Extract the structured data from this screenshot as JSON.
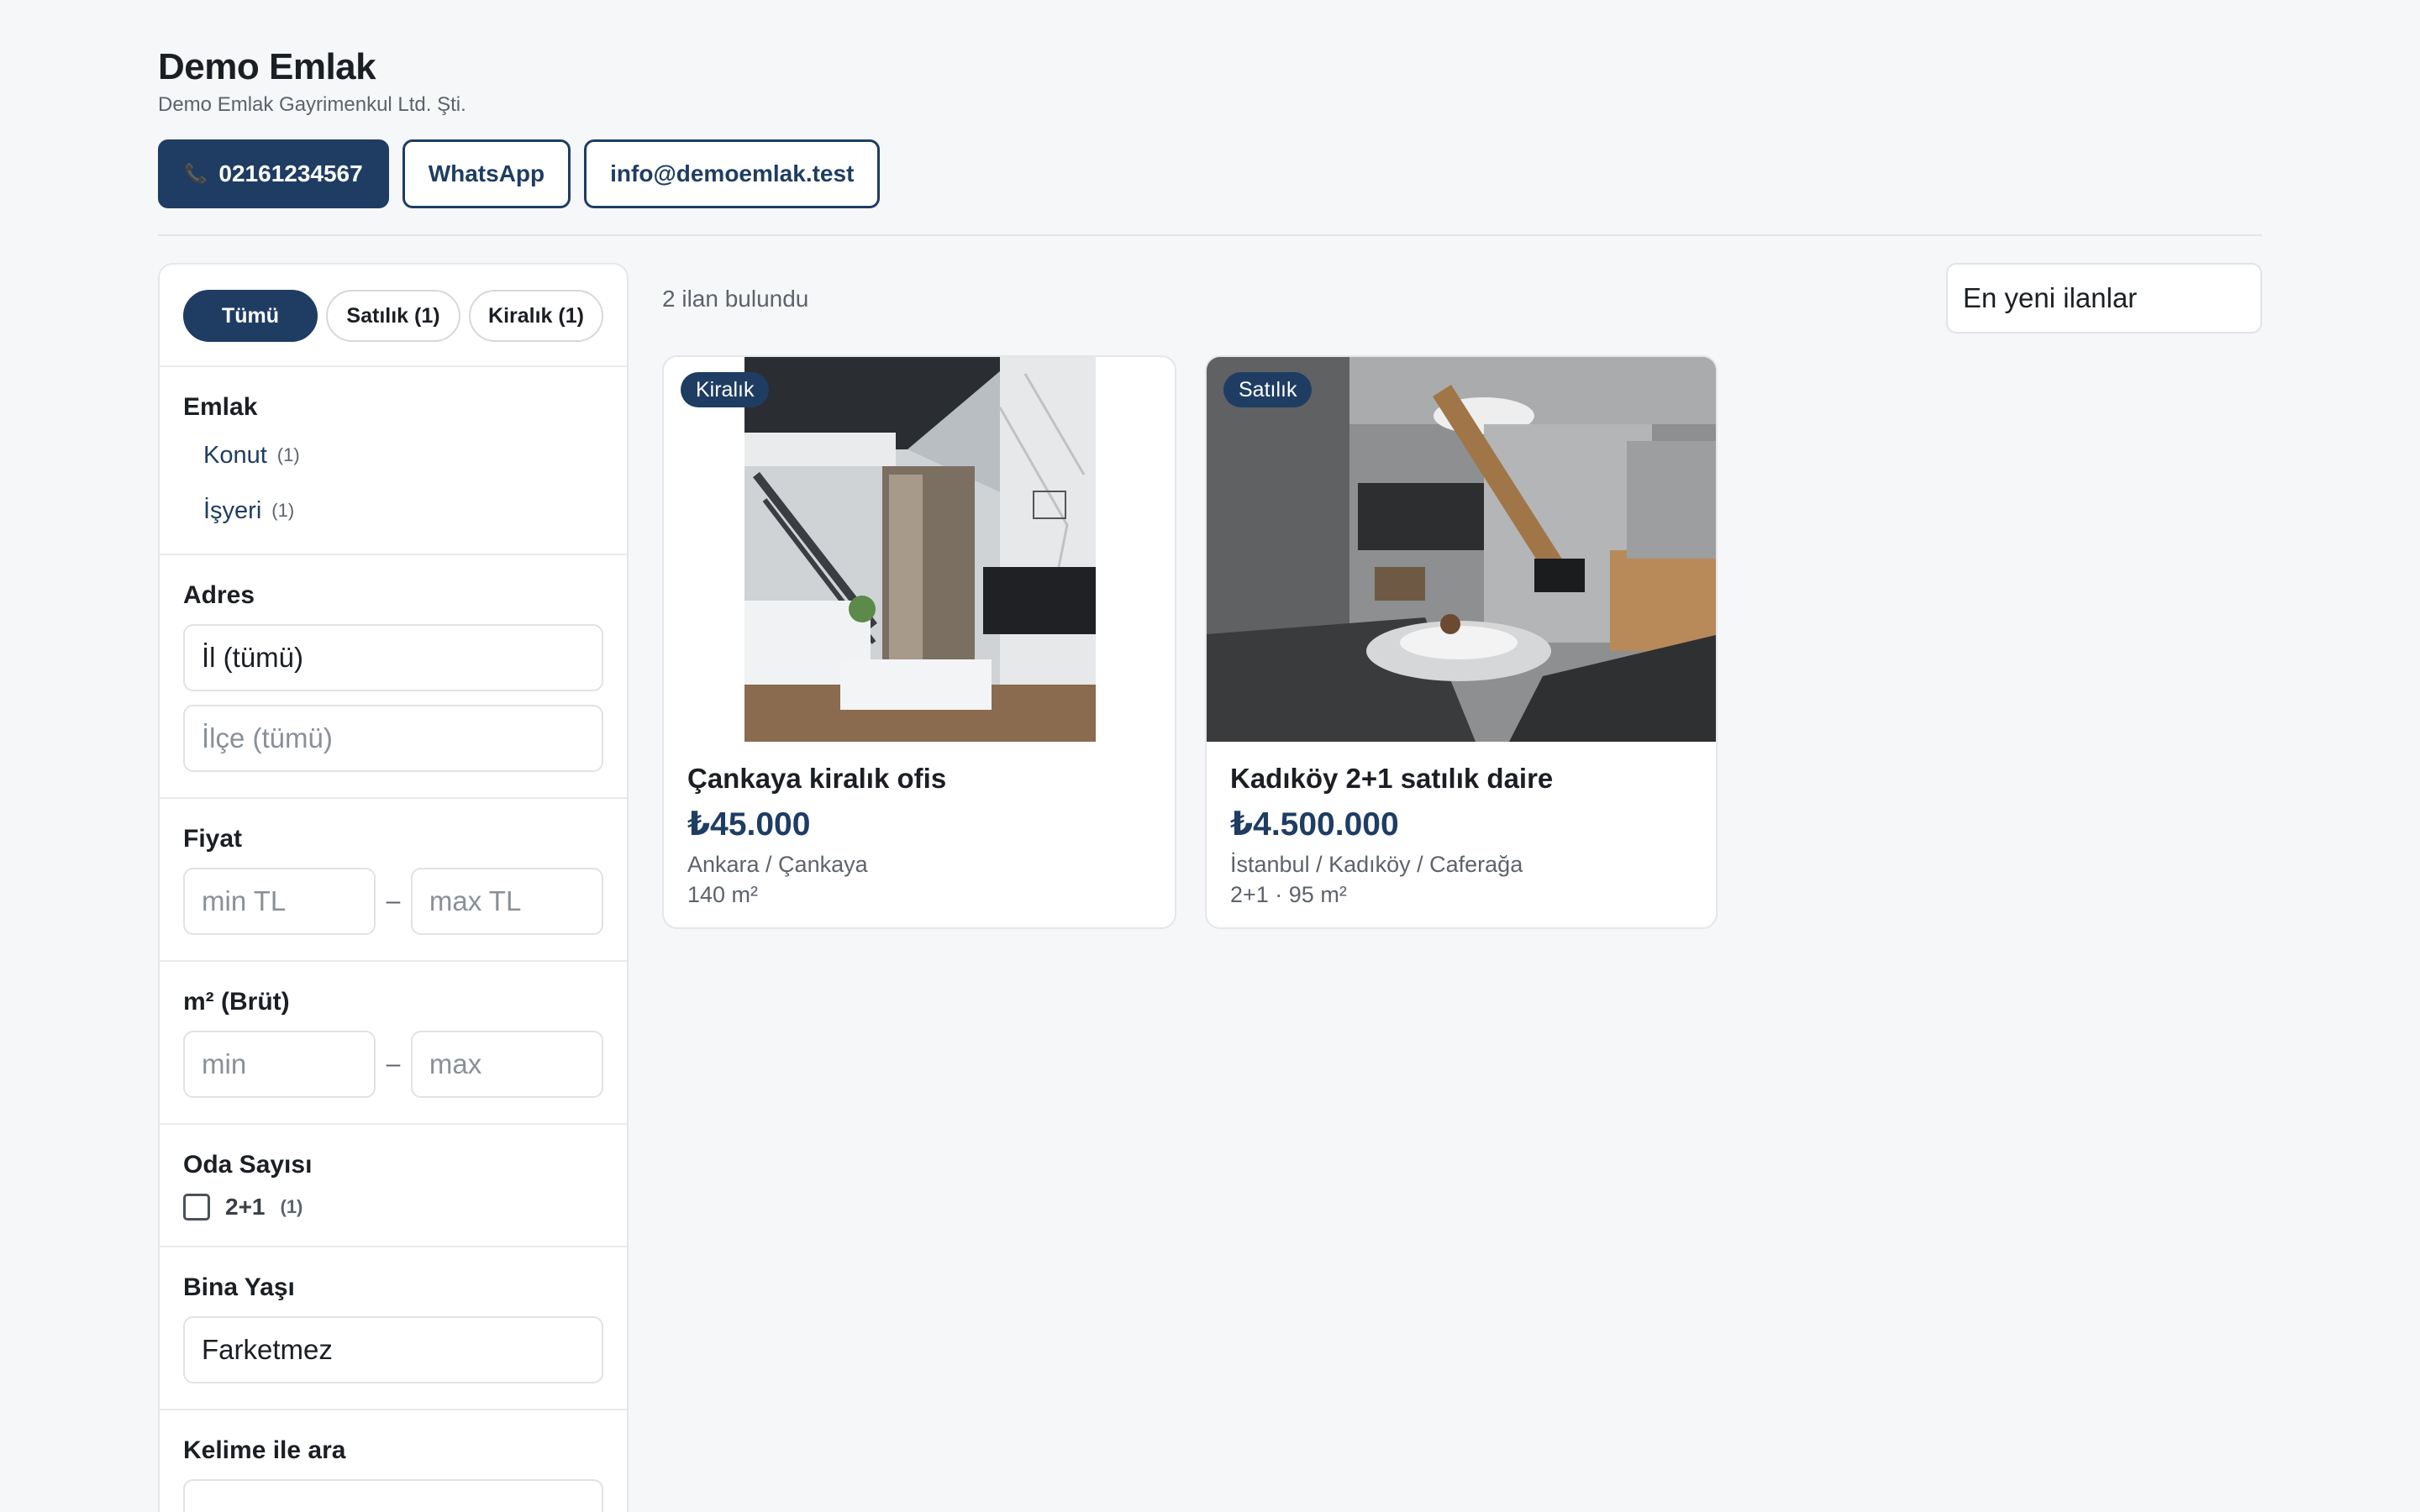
{
  "brand": {
    "title": "Demo Emlak",
    "subtitle": "Demo Emlak Gayrimenkul Ltd. Şti."
  },
  "contact": {
    "phone": "02161234567",
    "whatsapp": "WhatsApp",
    "email": "info@demoemlak.test"
  },
  "tabs": [
    {
      "label": "Tümü",
      "active": true
    },
    {
      "label": "Satılık (1)",
      "active": false
    },
    {
      "label": "Kiralık (1)",
      "active": false
    }
  ],
  "filters": {
    "emlak": {
      "title": "Emlak",
      "items": [
        {
          "label": "Konut",
          "count": "(1)"
        },
        {
          "label": "İşyeri",
          "count": "(1)"
        }
      ]
    },
    "adres": {
      "title": "Adres",
      "il": "İl (tümü)",
      "ilce": "İlçe (tümü)"
    },
    "fiyat": {
      "title": "Fiyat",
      "min_placeholder": "min TL",
      "max_placeholder": "max TL",
      "sep": "–"
    },
    "m2": {
      "title": "m² (Brüt)",
      "min_placeholder": "min",
      "max_placeholder": "max",
      "sep": "–"
    },
    "oda": {
      "title": "Oda Sayısı",
      "option_label": "2+1",
      "option_count": "(1)"
    },
    "bina_yasi": {
      "title": "Bina Yaşı",
      "value": "Farketmez"
    },
    "kelime": {
      "title": "Kelime ile ara"
    }
  },
  "results": {
    "count_text": "2 ilan bulundu",
    "sort_value": "En yeni ilanlar"
  },
  "listings": [
    {
      "badge": "Kiralık",
      "title": "Çankaya kiralık ofis",
      "price": "₺45.000",
      "location": "Ankara / Çankaya",
      "spec": "140 m²"
    },
    {
      "badge": "Satılık",
      "title": "Kadıköy 2+1 satılık daire",
      "price": "₺4.500.000",
      "location": "İstanbul / Kadıköy / Caferağa",
      "spec": "2+1 · 95 m²"
    }
  ],
  "colors": {
    "primary": "#1f3d63",
    "background": "#f6f7f9",
    "border": "#e4e6ea",
    "muted": "#5d636b"
  },
  "icons": {
    "phone": "phone-icon"
  }
}
